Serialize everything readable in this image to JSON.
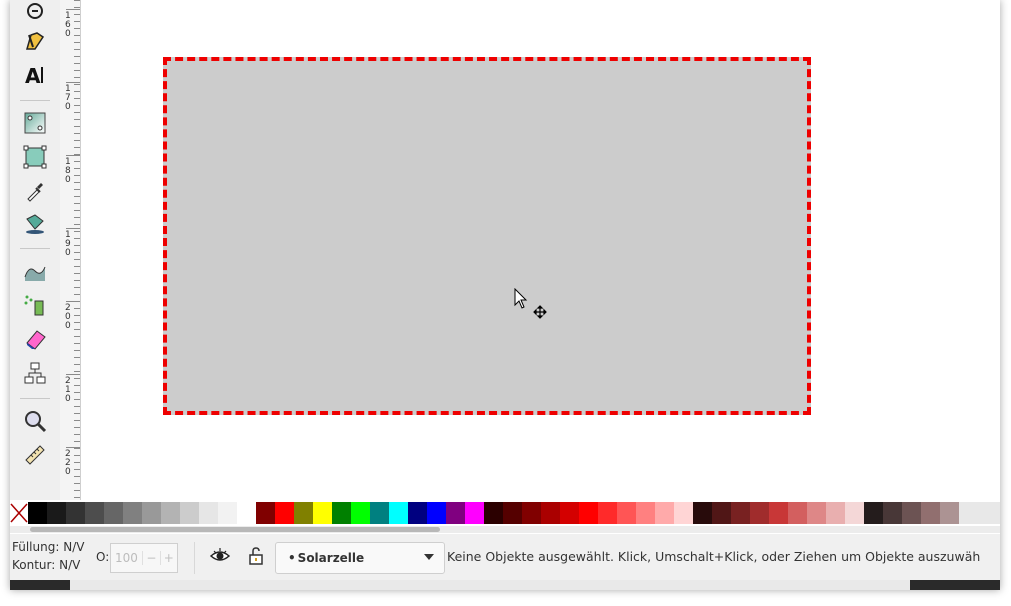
{
  "statusbar": {
    "fill_label": "Füllung:",
    "fill_value": "N/V",
    "stroke_label": "Kontur:",
    "stroke_value": "N/V",
    "opacity_label": "O:",
    "opacity_value": "100",
    "opacity_minus": "−",
    "opacity_plus": "+",
    "layer_bullet": "•",
    "layer_name": "Solarzelle",
    "message": "Keine Objekte ausgewählt. Klick, Umschalt+Klick, oder Ziehen um Objekte auszuwäh"
  },
  "ruler": {
    "labels": [
      {
        "digits": [
          "1",
          "6",
          "0"
        ]
      },
      {
        "digits": [
          "1",
          "7",
          "0"
        ]
      },
      {
        "digits": [
          "1",
          "8",
          "0"
        ]
      },
      {
        "digits": [
          "1",
          "9",
          "0"
        ]
      },
      {
        "digits": [
          "2",
          "0",
          "0"
        ]
      },
      {
        "digits": [
          "2",
          "1",
          "0"
        ]
      },
      {
        "digits": [
          "2",
          "2",
          "0"
        ]
      }
    ]
  },
  "canvas": {
    "rect_fill": "#cccccc",
    "rect_stroke": "#ee0000"
  },
  "tools": [
    "calligraphy-tool-icon",
    "pen-tool-icon",
    "text-tool-icon",
    "gradient-tool-icon",
    "mesh-tool-icon",
    "dropper-tool-icon",
    "paint-bucket-tool-icon",
    "tweak-tool-icon",
    "spray-tool-icon",
    "eraser-tool-icon",
    "connector-tool-icon",
    "zoom-tool-icon",
    "measure-tool-icon"
  ],
  "palette": [
    "#000000",
    "#1a1a1a",
    "#333333",
    "#4d4d4d",
    "#666666",
    "#808080",
    "#999999",
    "#b3b3b3",
    "#cccccc",
    "#e6e6e6",
    "#f2f2f2",
    "#ffffff",
    "#800000",
    "#ff0000",
    "#808000",
    "#ffff00",
    "#008000",
    "#00ff00",
    "#008080",
    "#00ffff",
    "#000080",
    "#0000ff",
    "#800080",
    "#ff00ff",
    "#2b0000",
    "#550000",
    "#800000",
    "#aa0000",
    "#d40000",
    "#ff0000",
    "#ff2a2a",
    "#ff5555",
    "#ff8080",
    "#ffaaaa",
    "#ffd5d5",
    "#280b0b",
    "#501616",
    "#782121",
    "#a02c2c",
    "#c83737",
    "#d35f5f",
    "#de8787",
    "#e9afaf",
    "#f4d7d7",
    "#241c1c",
    "#483737",
    "#6c5353",
    "#916f6f",
    "#ac9393"
  ]
}
